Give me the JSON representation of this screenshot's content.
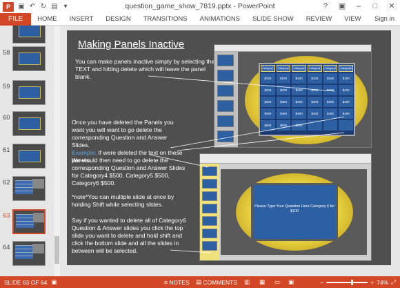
{
  "window": {
    "title": "question_game_show_7819.pptx - PowerPoint",
    "app_badge": "P",
    "controls": [
      "?",
      "▣",
      "–",
      "□",
      "✕"
    ]
  },
  "qat_icons": [
    "save-icon",
    "undo-icon",
    "redo-icon",
    "start-slideshow-icon",
    "customize-icon"
  ],
  "ribbon": {
    "file": "FILE",
    "tabs": [
      "HOME",
      "INSERT",
      "DESIGN",
      "TRANSITIONS",
      "ANIMATIONS",
      "SLIDE SHOW",
      "REVIEW",
      "VIEW"
    ],
    "signin": "Sign in"
  },
  "thumbnails": [
    {
      "num": "58",
      "kind": "blue"
    },
    {
      "num": "59",
      "kind": "blue"
    },
    {
      "num": "60",
      "kind": "blue"
    },
    {
      "num": "61",
      "kind": "blue"
    },
    {
      "num": "62",
      "kind": "grid"
    },
    {
      "num": "63",
      "kind": "grid",
      "active": true
    },
    {
      "num": "64",
      "kind": "grid"
    }
  ],
  "slide": {
    "title": "Making Panels Inactive",
    "p1": "You can make panels inactive simply by selecting the TEXT and hitting delete which will leave the panel blank.",
    "p2a": "Once you have deleted the Panels you want you will want to go delete the corresponding Question and Answer Slides.",
    "p2_example_label": "Example:",
    "p2b": " If were deleted the text on these panels.",
    "p3": "We would then need to go delete the corresponding Question and Answer Slides for Category4 $500, Category5 $500, Category6 $500.",
    "p4": "*note*You can multiple slide at once by holding Shift while selecting slides.",
    "p5": "Say if you wanted to delete all of Category6 Question & Answer slides you click the top slide you want to delete and hold shift and click the bottom slide and all the slides in between will be selected.",
    "board_headers": [
      "Category1",
      "Category2",
      "Category3",
      "Category4",
      "Category5",
      "Category6"
    ],
    "board_rows": [
      [
        "$100",
        "$100",
        "$100",
        "$100",
        "$100",
        "$100"
      ],
      [
        "$200",
        "$200",
        "$200",
        "$200",
        "$200",
        "$200"
      ],
      [
        "$300",
        "$300",
        "$300",
        "$300",
        "$300",
        "$300"
      ],
      [
        "$400",
        "$400",
        "$400",
        "$400",
        "$400",
        "$400"
      ],
      [
        "$500",
        "$500",
        "$500",
        "",
        "",
        ""
      ]
    ],
    "question_box": "Please Type Your Question Here Category 6 for $100"
  },
  "status": {
    "slide_info": "SLIDE 63 OF 64",
    "notes": "NOTES",
    "comments": "COMMENTS",
    "zoom": "74%",
    "zoom_fraction": 0.74
  },
  "colors": {
    "accent": "#d24726",
    "slide_bg": "#4f4f4f",
    "panel_blue": "#2d5fa3",
    "gold": "#f2df4b"
  }
}
